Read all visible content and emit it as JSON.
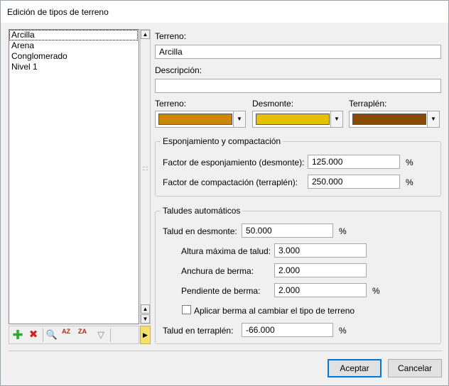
{
  "window": {
    "title": "Edición de tipos de terreno"
  },
  "list": {
    "items": [
      "Arcilla",
      "Arena",
      "Conglomerado",
      "Nivel 1"
    ],
    "selected_index": 0
  },
  "toolbar": {
    "icons": [
      "add-icon",
      "delete-icon",
      "search-icon",
      "sort-az-icon",
      "sort-za-icon",
      "filter-icon"
    ],
    "add_glyph": "✚",
    "delete_glyph": "✖",
    "search_glyph": "🔍",
    "sort_az_glyph": "AZ",
    "sort_za_glyph": "ZA",
    "filter_glyph": "▽",
    "more_glyph": "▶"
  },
  "form": {
    "terreno_label": "Terreno:",
    "terreno_value": "Arcilla",
    "descripcion_label": "Descripción:",
    "descripcion_value": "",
    "colors": {
      "terreno_label": "Terreno:",
      "desmonte_label": "Desmonte:",
      "terraplen_label": "Terraplén:",
      "terreno_color": "#cc8800",
      "desmonte_color": "#e6c000",
      "terraplen_color": "#8a4a00"
    },
    "esponjamiento": {
      "title": "Esponjamiento y compactación",
      "factor_esponjamiento_label": "Factor de esponjamiento (desmonte):",
      "factor_esponjamiento_value": "125.000",
      "factor_esponjamiento_unit": "%",
      "factor_compactacion_label": "Factor de compactación (terraplén):",
      "factor_compactacion_value": "250.000",
      "factor_compactacion_unit": "%"
    },
    "taludes": {
      "title": "Taludes automáticos",
      "talud_desmonte_label": "Talud en desmonte:",
      "talud_desmonte_value": "50.000",
      "talud_desmonte_unit": "%",
      "altura_label": "Altura máxima de talud:",
      "altura_value": "3.000",
      "anchura_label": "Anchura de berma:",
      "anchura_value": "2.000",
      "pendiente_label": "Pendiente de berma:",
      "pendiente_value": "2.000",
      "pendiente_unit": "%",
      "aplicar_label": "Aplicar berma al cambiar el tipo de terreno",
      "aplicar_checked": false,
      "talud_terraplen_label": "Talud en terraplén:",
      "talud_terraplen_value": "-66.000",
      "talud_terraplen_unit": "%"
    }
  },
  "buttons": {
    "accept": "Aceptar",
    "cancel": "Cancelar"
  }
}
